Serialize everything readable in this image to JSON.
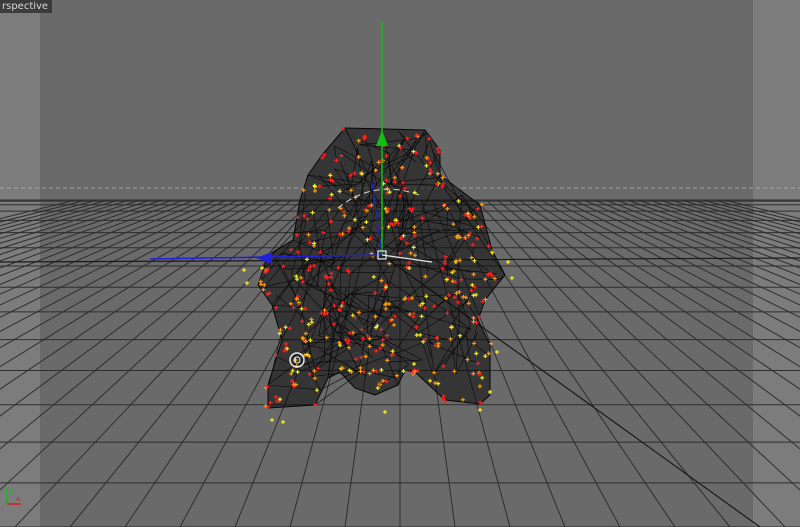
{
  "viewport": {
    "label": "rspective",
    "camera_name_full": "persp",
    "colors": {
      "background": "#6a6a6a",
      "side_panel": "#7c7c7c",
      "grid": "#2e2e2e",
      "mesh_wire": "#050505",
      "vertex_red": "#ff2020",
      "vertex_orange": "#ff9a10",
      "vertex_yellow": "#f2ee20",
      "manip_x": "#2020d8",
      "manip_y": "#10c010",
      "manip_center": "#e8e8e8"
    },
    "icons": {
      "move_manipulator": "move-manipulator-icon",
      "view_axis": "xyz-axis-icon",
      "soft_select_ring": "selection-ring-icon"
    }
  },
  "axis_indicator": {
    "x_label": "x",
    "y_label": "y"
  }
}
